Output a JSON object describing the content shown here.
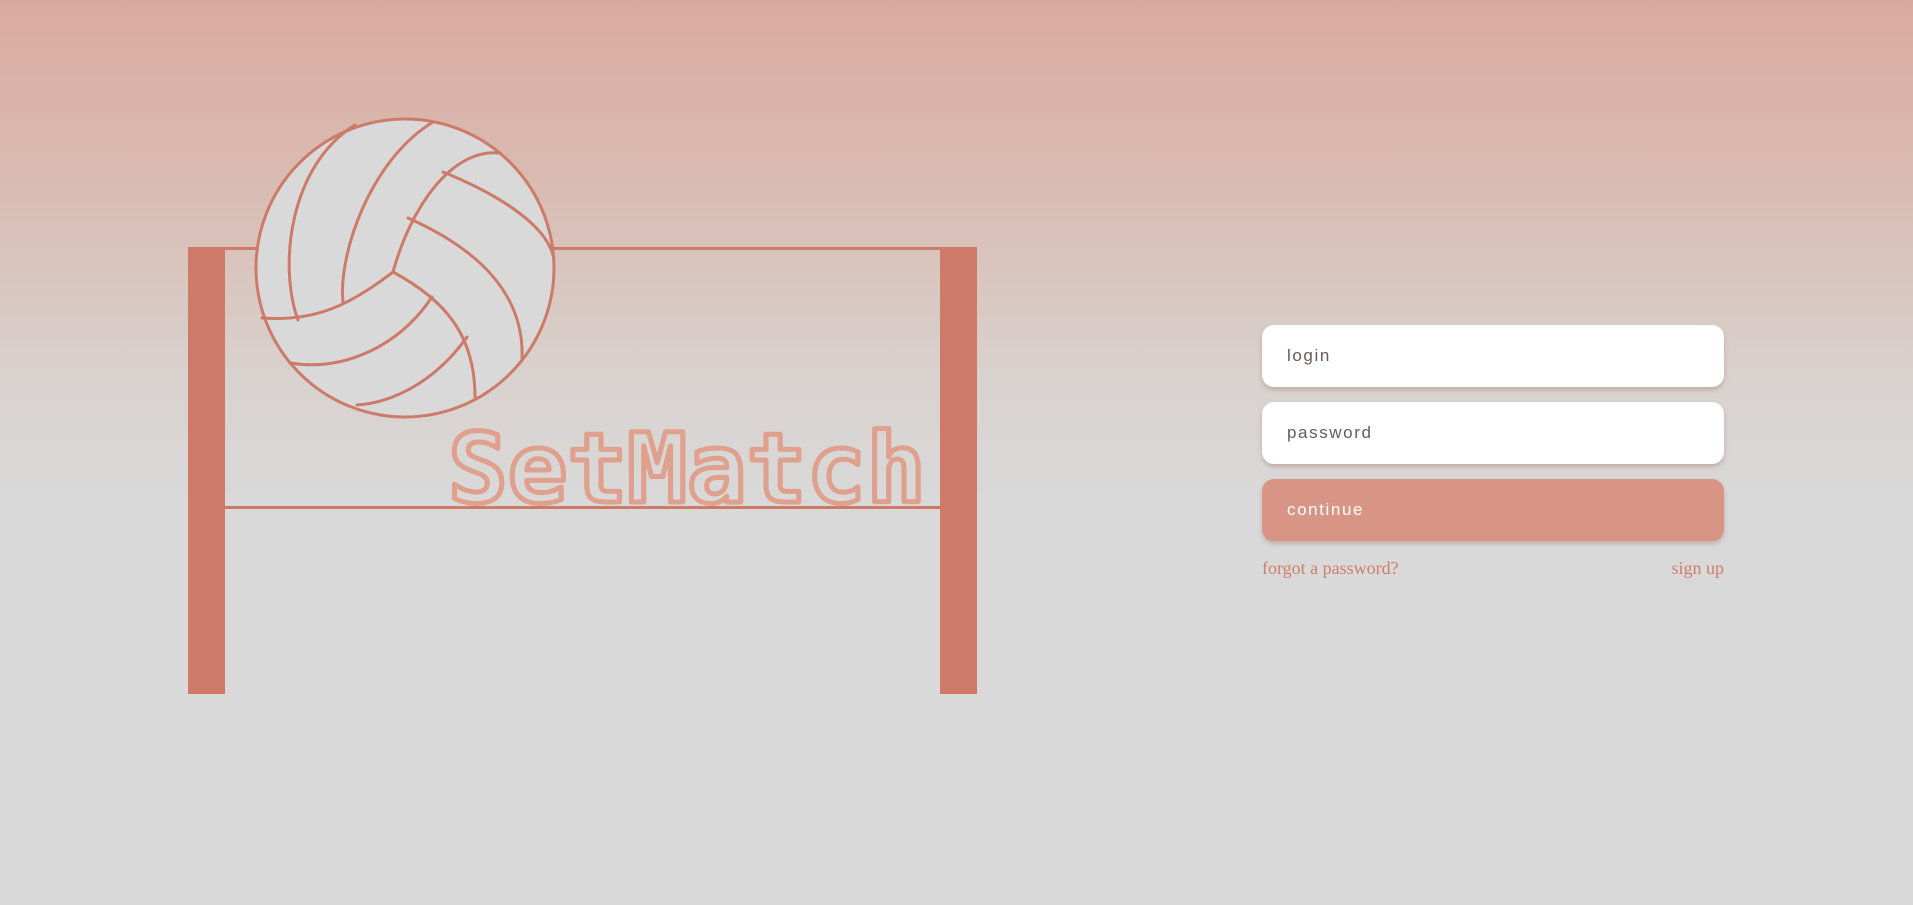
{
  "brand": {
    "name": "SetMatch"
  },
  "colors": {
    "accent": "#cd7b68",
    "button": "#d89585",
    "logo_text": "#e0a08e",
    "background": "#d9d9d9"
  },
  "form": {
    "login_placeholder": "login",
    "password_placeholder": "password",
    "continue_label": "continue",
    "forgot_label": "forgot a password?",
    "signup_label": "sign up"
  }
}
